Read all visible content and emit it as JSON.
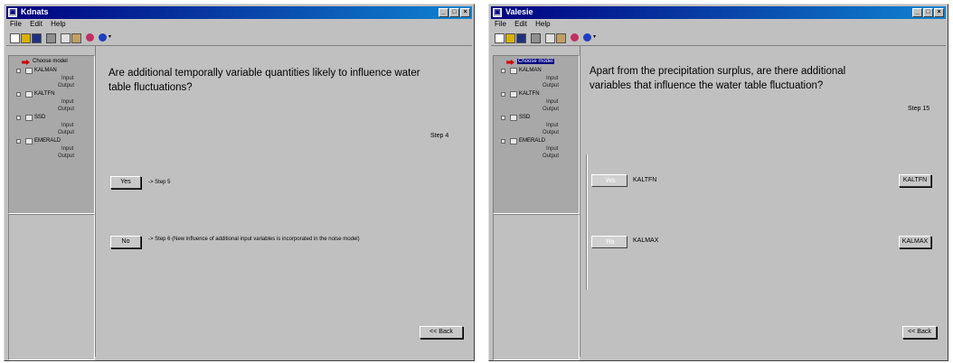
{
  "windows": [
    {
      "title": "Kdnats",
      "menu": [
        "File",
        "Edit",
        "Help"
      ],
      "tree": {
        "root": "Choose model",
        "models": [
          {
            "name": "KALMAN",
            "children": [
              "Input",
              "Output"
            ]
          },
          {
            "name": "KALTFN",
            "children": [
              "Input",
              "Output"
            ]
          },
          {
            "name": "SSD",
            "children": [
              "Input",
              "Output"
            ]
          },
          {
            "name": "EMERALD",
            "children": [
              "Input",
              "Output"
            ]
          }
        ]
      },
      "question": "Are additional temporally variable quantities likely to influence water table fluctuations?",
      "step": "Step 4",
      "yes_label": "Yes",
      "yes_note": "-> Step 5",
      "no_label": "No",
      "no_note": "-> Step 6 (New influence of additional input variables is incorporated in the noise model)",
      "back_label": "<< Back"
    },
    {
      "title": "Valesie",
      "menu": [
        "File",
        "Edit",
        "Help"
      ],
      "tree": {
        "root": "Choose model",
        "models": [
          {
            "name": "KALMAN",
            "children": [
              "Input",
              "Output"
            ]
          },
          {
            "name": "KALTFN",
            "children": [
              "Input",
              "Output"
            ]
          },
          {
            "name": "SSD",
            "children": [
              "Input",
              "Output"
            ]
          },
          {
            "name": "EMERALD",
            "children": [
              "Input",
              "Output"
            ]
          }
        ]
      },
      "question": "Apart from the precipitation surplus, are there additional variables that influence the water table fluctuation?",
      "step": "Step 15",
      "options": [
        {
          "left_label": "Yes",
          "name": "KALTFN",
          "right_label": "KALTFN"
        },
        {
          "left_label": "No",
          "name": "KALMAX",
          "right_label": "KALMAX"
        }
      ],
      "back_label": "<< Back"
    }
  ]
}
